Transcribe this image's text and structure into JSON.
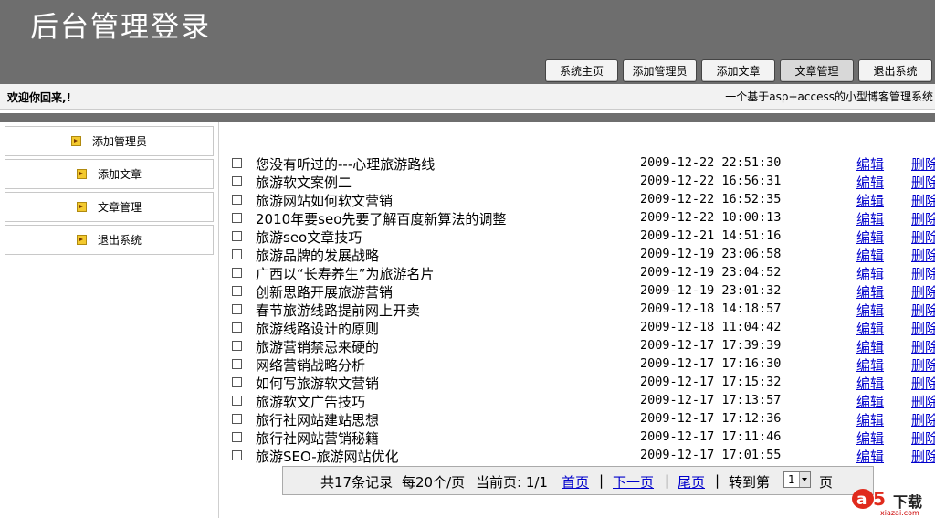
{
  "header": {
    "title": "后台管理登录"
  },
  "nav": [
    {
      "label": "系统主页",
      "active": false
    },
    {
      "label": "添加管理员",
      "active": false
    },
    {
      "label": "添加文章",
      "active": false
    },
    {
      "label": "文章管理",
      "active": true
    },
    {
      "label": "退出系统",
      "active": false
    }
  ],
  "welcome": {
    "left": "欢迎你回来,!",
    "right": "一个基于asp+access的小型博客管理系统"
  },
  "sidebar": [
    {
      "label": "添加管理员"
    },
    {
      "label": "添加文章"
    },
    {
      "label": "文章管理"
    },
    {
      "label": "退出系统"
    }
  ],
  "articles": {
    "edit_label": "编辑",
    "delete_label": "删除",
    "rows": [
      {
        "title": "您没有听过的---心理旅游路线",
        "date": "2009-12-22 22:51:30"
      },
      {
        "title": "旅游软文案例二",
        "date": "2009-12-22 16:56:31"
      },
      {
        "title": "旅游网站如何软文营销",
        "date": "2009-12-22 16:52:35"
      },
      {
        "title": "2010年要seo先要了解百度新算法的调整",
        "date": "2009-12-22 10:00:13"
      },
      {
        "title": "旅游seo文章技巧",
        "date": "2009-12-21 14:51:16"
      },
      {
        "title": "旅游品牌的发展战略",
        "date": "2009-12-19 23:06:58"
      },
      {
        "title": "广西以“长寿养生”为旅游名片",
        "date": "2009-12-19 23:04:52"
      },
      {
        "title": "创新思路开展旅游营销",
        "date": "2009-12-19 23:01:32"
      },
      {
        "title": "春节旅游线路提前网上开卖",
        "date": "2009-12-18 14:18:57"
      },
      {
        "title": "旅游线路设计的原则",
        "date": "2009-12-18 11:04:42"
      },
      {
        "title": "旅游营销禁忌来硬的",
        "date": "2009-12-17 17:39:39"
      },
      {
        "title": "网络营销战略分析",
        "date": "2009-12-17 17:16:30"
      },
      {
        "title": "如何写旅游软文营销",
        "date": "2009-12-17 17:15:32"
      },
      {
        "title": "旅游软文广告技巧",
        "date": "2009-12-17 17:13:57"
      },
      {
        "title": "旅行社网站建站思想",
        "date": "2009-12-17 17:12:36"
      },
      {
        "title": "旅行社网站营销秘籍",
        "date": "2009-12-17 17:11:46"
      },
      {
        "title": "旅游SEO-旅游网站优化",
        "date": "2009-12-17 17:01:55"
      }
    ]
  },
  "pager": {
    "total_text": "共17条记录",
    "per_page_text": "每20个/页",
    "current_text": "当前页: 1/1",
    "first": "首页",
    "next": "下一页",
    "last": "尾页",
    "sep": "|",
    "goto_text": "转到第",
    "page_value": "1",
    "page_unit": "页"
  },
  "watermark": {
    "brand": "a5",
    "text": "下载",
    "sub": "xiazai.com"
  }
}
